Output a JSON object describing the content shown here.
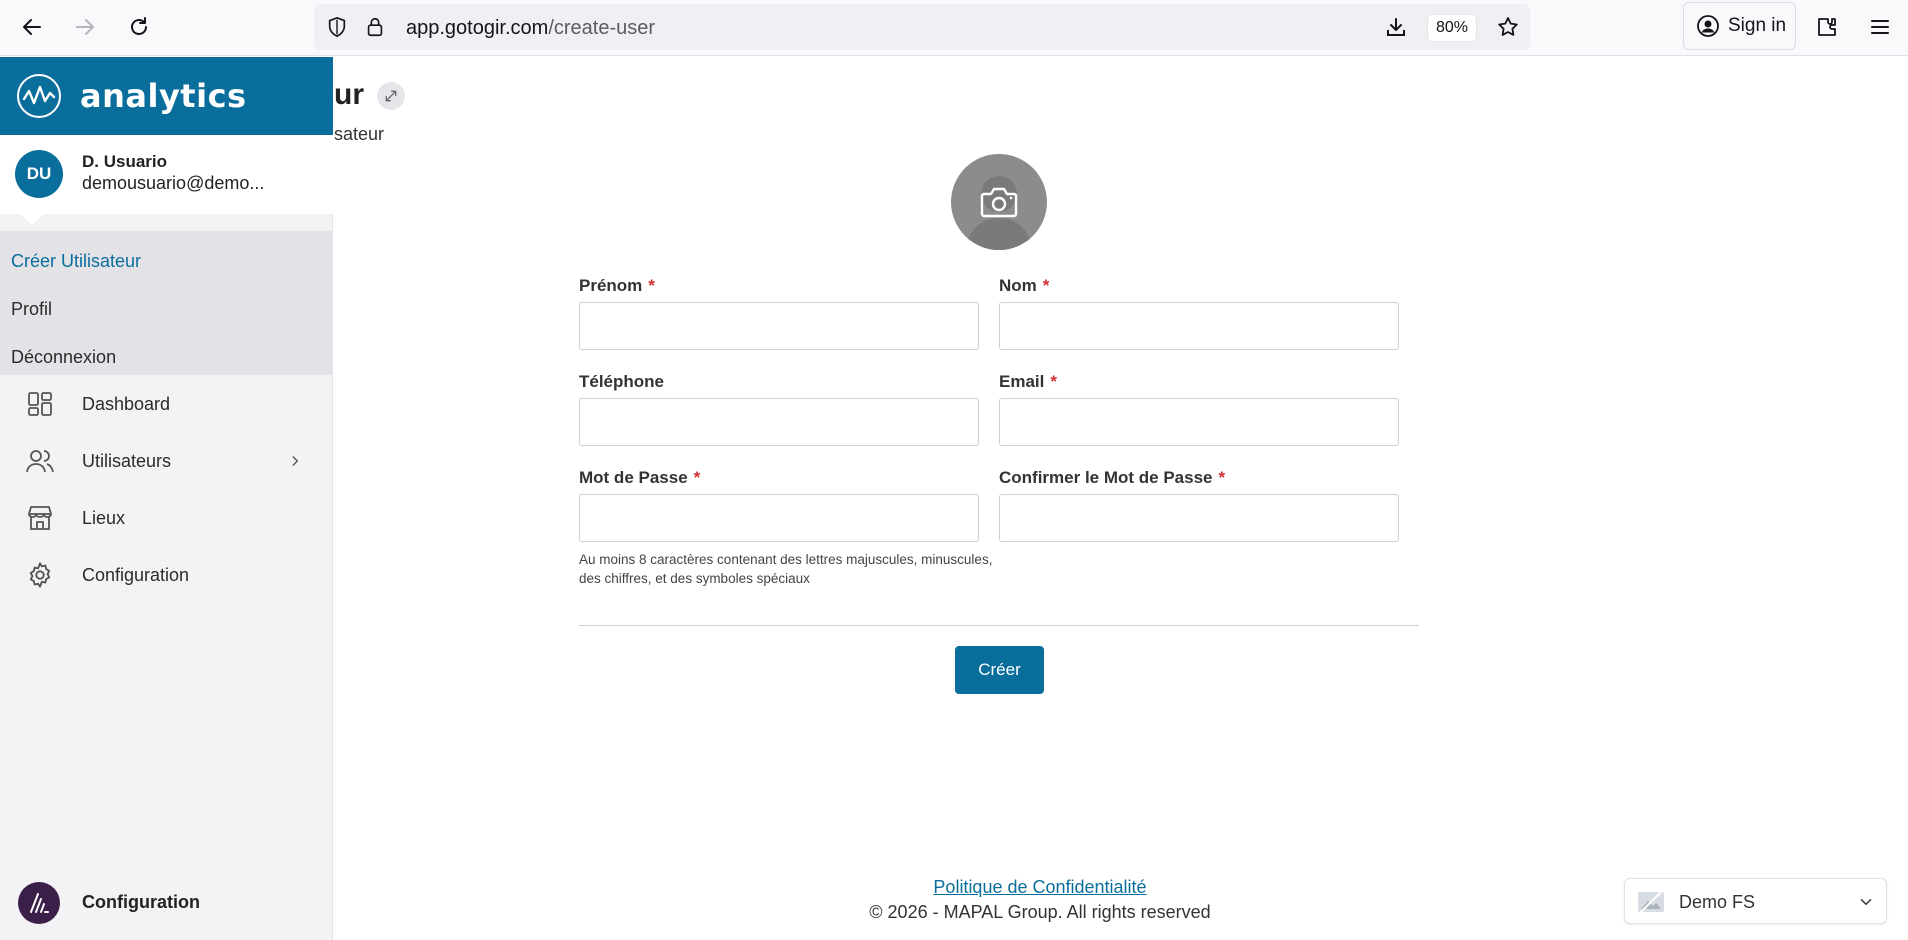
{
  "browser": {
    "url_host": "app.gotogir.com",
    "url_path": "/create-user",
    "zoom": "80%",
    "sign_in": "Sign in"
  },
  "sidebar": {
    "brand": "analytics",
    "user": {
      "initials": "DU",
      "name": "D. Usuario",
      "email": "demousuario@demo..."
    },
    "submenu": [
      {
        "label": "Créer Utilisateur"
      },
      {
        "label": "Profil"
      },
      {
        "label": "Déconnexion"
      }
    ],
    "menu": [
      {
        "label": "Dashboard",
        "icon": "dashboard-icon"
      },
      {
        "label": "Utilisateurs",
        "icon": "users-icon"
      },
      {
        "label": "Lieux",
        "icon": "store-icon"
      },
      {
        "label": "Configuration",
        "icon": "gear-icon"
      }
    ],
    "bottom": {
      "label": "Configuration",
      "icon": "app-logo-icon"
    }
  },
  "main": {
    "title_partial": "ur",
    "subtitle_partial": "sateur",
    "form": {
      "first_name_label": "Prénom",
      "last_name_label": "Nom",
      "phone_label": "Téléphone",
      "email_label": "Email",
      "password_label": "Mot de Passe",
      "confirm_password_label": "Confirmer le Mot de Passe",
      "required_mark": "*",
      "password_hint": "Au moins 8 caractères contenant des lettres majuscules, minuscules, des chiffres, et des symboles spéciaux",
      "submit": "Créer"
    }
  },
  "footer": {
    "privacy": "Politique de Confidentialité",
    "copyright": "© 2026 - MAPAL Group. All rights reserved"
  },
  "org_selector": {
    "value": "Demo FS"
  },
  "colors": {
    "brand": "#0a6e9c",
    "required": "#d32f2f"
  }
}
